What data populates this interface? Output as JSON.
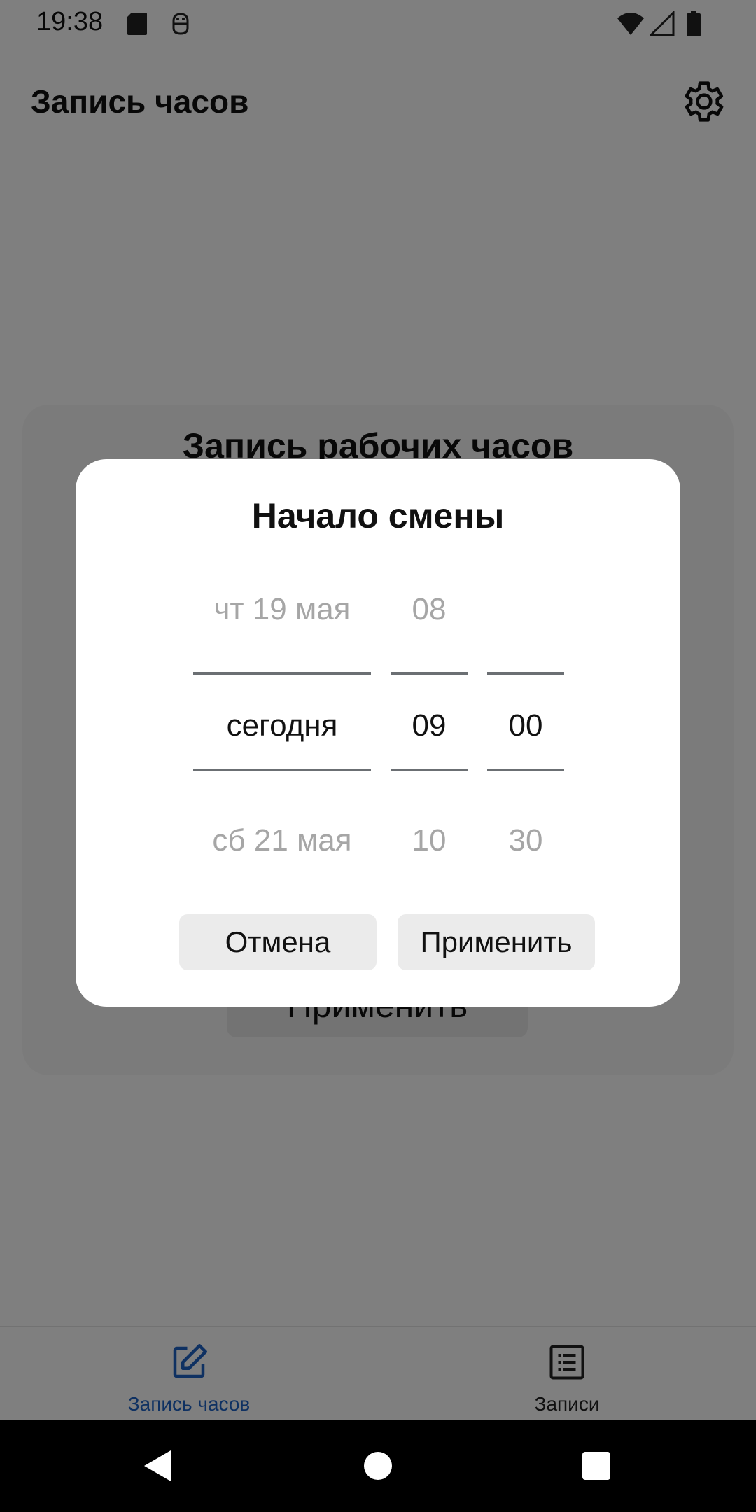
{
  "status_bar": {
    "time": "19:38",
    "icons": [
      "sd-card-icon",
      "android-debug-icon",
      "wifi-icon",
      "signal-icon",
      "battery-icon"
    ]
  },
  "app_bar": {
    "title": "Запись часов",
    "settings_icon": "gear-icon"
  },
  "background_card": {
    "title": "Запись рабочих часов",
    "apply_label": "Применить"
  },
  "dialog": {
    "title": "Начало смены",
    "date_column": {
      "prev": "чт 19 мая",
      "selected": "сегодня",
      "next": "сб 21 мая"
    },
    "hour_column": {
      "prev": "08",
      "selected": "09",
      "next": "10"
    },
    "minute_column": {
      "prev": "",
      "selected": "00",
      "next": "30"
    },
    "cancel_label": "Отмена",
    "apply_label": "Применить"
  },
  "bottom_nav": {
    "items": [
      {
        "label": "Запись часов",
        "icon": "edit-icon",
        "active": true
      },
      {
        "label": "Записи",
        "icon": "list-icon",
        "active": false
      }
    ]
  },
  "system_nav": {
    "icons": [
      "back-icon",
      "home-icon",
      "recents-icon"
    ]
  },
  "colors": {
    "accent": "#1e63c5",
    "divider": "#6b6f73",
    "scrim": "rgba(0,0,0,0.5)"
  }
}
